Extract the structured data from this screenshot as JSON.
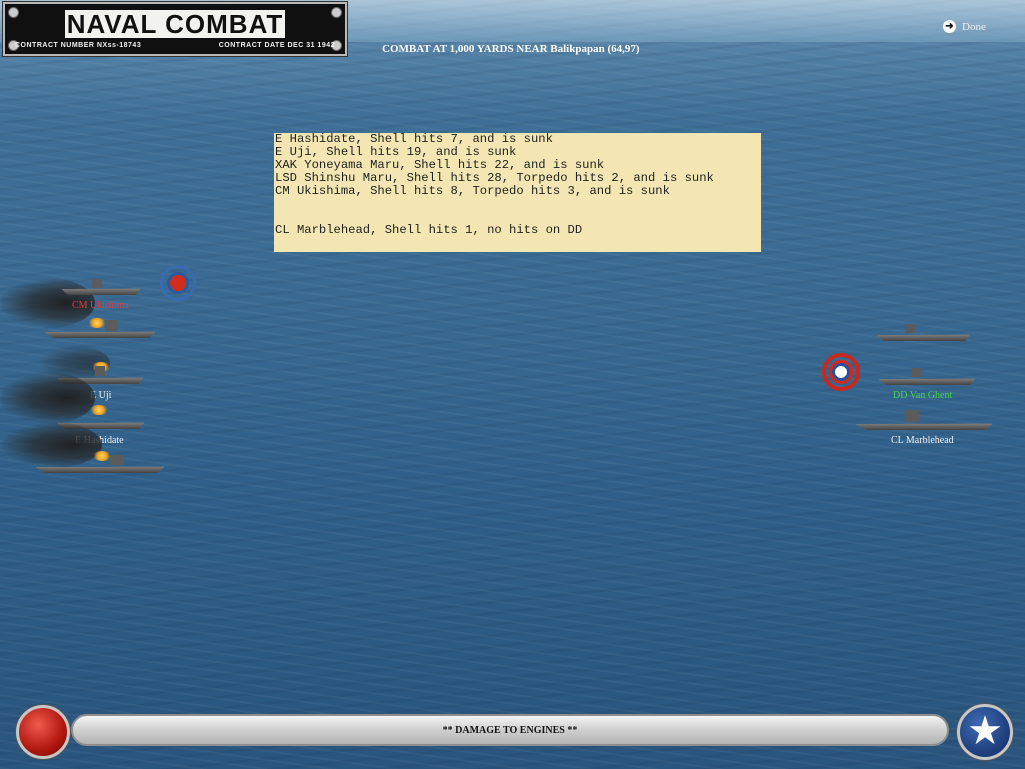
{
  "title_plate": {
    "title": "NAVAL COMBAT",
    "contract_number_label": "CONTRACT NUMBER",
    "contract_number": "NXss-18743",
    "contract_date_label": "CONTRACT DATE",
    "contract_date": "DEC 31 1942"
  },
  "header": {
    "combat_text": "COMBAT AT 1,000 YARDS NEAR Balikpapan (64,97)",
    "done_label": "Done"
  },
  "combat_log": [
    "E Hashidate, Shell hits 7, and is sunk",
    "E Uji, Shell hits 19, and is sunk",
    "XAK Yoneyama Maru, Shell hits 22, and is sunk",
    "LSD Shinshu Maru, Shell hits 28, Torpedo hits 2, and is sunk",
    "CM Ukishima, Shell hits 8, Torpedo hits 3, and is sunk",
    "",
    "",
    "CL Marblehead, Shell hits 1, no hits on DD"
  ],
  "japanese_ships": {
    "label_1": "CM Ukishima",
    "label_2": "E Uji",
    "label_3": "E Hashidate"
  },
  "allied_ships": {
    "label_1": "DD Van Ghent",
    "label_2": "CL Marblehead"
  },
  "status_bar": {
    "message": "** DAMAGE TO ENGINES **"
  },
  "colors": {
    "log_background": "#f3e6b2",
    "enemy_label": "#e63a3a",
    "friendly_highlight": "#41d64a"
  },
  "icons": {
    "done": "arrow-circle-icon",
    "japan_button": "red-circle-icon",
    "us_button": "white-star-icon"
  }
}
